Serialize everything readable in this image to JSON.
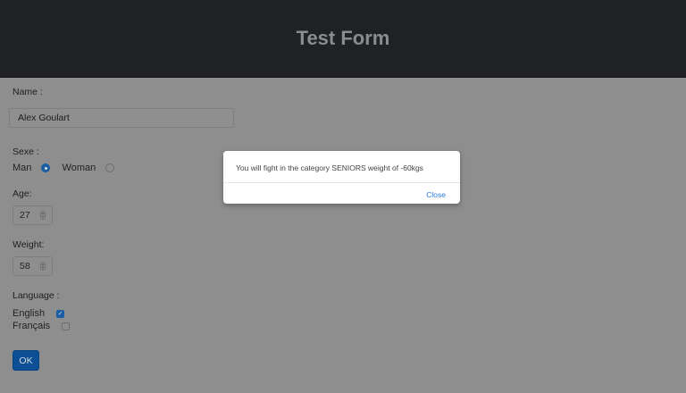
{
  "header": {
    "title": "Test Form"
  },
  "form": {
    "name_label": "Name :",
    "name_value": "Alex Goulart",
    "sexe_label": "Sexe :",
    "sexe_options": [
      "Man",
      "Woman"
    ],
    "sexe_selected": "Man",
    "age_label": "Age:",
    "age_value": "27",
    "weight_label": "Weight:",
    "weight_value": "58",
    "language_label": "Language :",
    "languages": [
      {
        "label": "English",
        "checked": true
      },
      {
        "label": "Français",
        "checked": false
      }
    ],
    "ok_label": "OK"
  },
  "modal": {
    "message": "You will fight in the category SENIORS weight of -60kgs",
    "close_label": "Close"
  },
  "colors": {
    "header_bg": "#1f2124",
    "accent": "#1a5fa3",
    "link": "#2a7de1"
  }
}
